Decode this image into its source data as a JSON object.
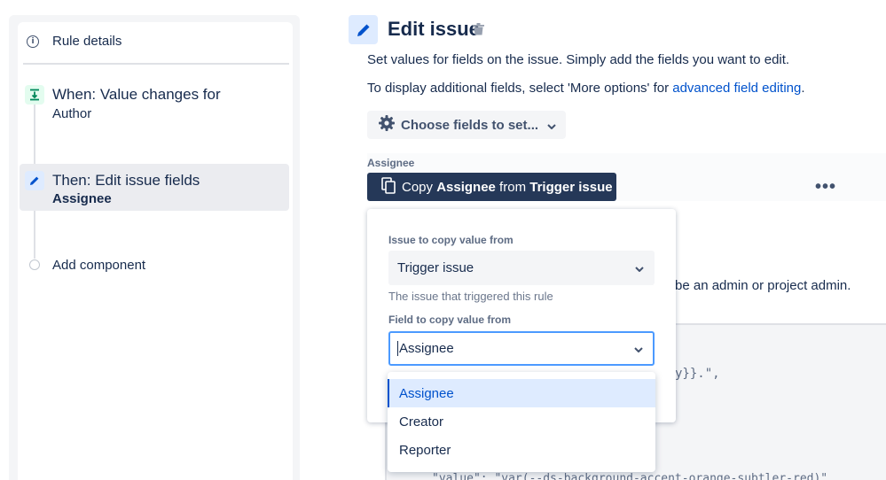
{
  "sidebar": {
    "rule_details": "Rule details",
    "when_title": "When: Value changes for",
    "when_sub": "Author",
    "then_title": "Then: Edit issue fields",
    "then_sub": "Assignee",
    "add_component": "Add component"
  },
  "main": {
    "title": "Edit issue",
    "description_1": "Set values for fields on the issue. Simply add the fields you want to edit.",
    "description_2_prefix": "To display additional fields, select 'More options' for ",
    "description_2_link": "advanced field editing",
    "description_2_suffix": ".",
    "choose_fields_label": "Choose fields to set...",
    "field_label": "Assignee",
    "copy_button": {
      "part1": "Copy ",
      "field": "Assignee",
      "part2": " from ",
      "source": "Trigger issue"
    },
    "more_options": "•••",
    "partial_text": "be an admin or project admin.",
    "code_fragment_1": "y}}.\",",
    "code_fragment_2": "\"value\": \"var(--ds-background-accent-orange-subtler-red)\","
  },
  "popup": {
    "issue_label": "Issue to copy value from",
    "issue_value": "Trigger issue",
    "issue_help": "The issue that triggered this rule",
    "field_label": "Field to copy value from",
    "field_value": "Assignee",
    "options": [
      "Assignee",
      "Creator",
      "Reporter"
    ],
    "selected_option": "Assignee"
  },
  "colors": {
    "accent": "#0052cc",
    "copy_button_bg": "#253858",
    "focus_border": "#4c9aff",
    "when_icon_bg": "#e3fcef",
    "then_icon_bg": "#deebff"
  },
  "icons": {
    "rule_details": "info-icon",
    "when": "trigger-icon",
    "then": "pencil-icon",
    "edit_header": "pencil-icon",
    "delete": "trash-icon",
    "choose_fields": "gear-icon",
    "copy": "copy-icon",
    "dropdown": "chevron-down-icon"
  }
}
